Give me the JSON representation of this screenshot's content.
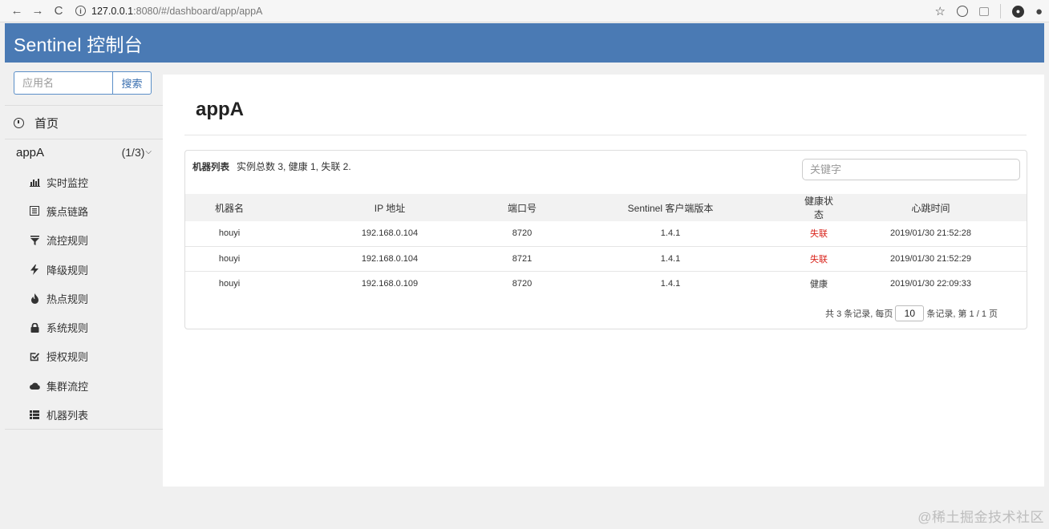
{
  "browser": {
    "url_host": "127.0.0.1",
    "url_rest": ":8080/#/dashboard/app/appA"
  },
  "header": {
    "title": "Sentinel 控制台"
  },
  "sidebar": {
    "search_placeholder": "应用名",
    "search_button": "搜索",
    "home_label": "首页",
    "app_name": "appA",
    "app_count": "(1/3)",
    "items": [
      {
        "label": "实时监控",
        "icon": "bar-chart-icon"
      },
      {
        "label": "簇点链路",
        "icon": "list-box-icon"
      },
      {
        "label": "流控规则",
        "icon": "filter-icon"
      },
      {
        "label": "降级规则",
        "icon": "flash-icon"
      },
      {
        "label": "热点规则",
        "icon": "fire-icon"
      },
      {
        "label": "系统规则",
        "icon": "lock-icon"
      },
      {
        "label": "授权规则",
        "icon": "check-square-icon"
      },
      {
        "label": "集群流控",
        "icon": "cloud-icon"
      },
      {
        "label": "机器列表",
        "icon": "th-list-icon"
      }
    ]
  },
  "main": {
    "title": "appA",
    "card_title": "机器列表",
    "summary": "实例总数 3, 健康 1, 失联 2.",
    "keyword_placeholder": "关键字",
    "columns": [
      "机器名",
      "IP 地址",
      "端口号",
      "Sentinel 客户端版本",
      "健康状态",
      "心跳时间"
    ],
    "rows": [
      {
        "name": "houyi",
        "ip": "192.168.0.104",
        "port": "8720",
        "version": "1.4.1",
        "status": "失联",
        "heartbeat": "2019/01/30 21:52:28"
      },
      {
        "name": "houyi",
        "ip": "192.168.0.104",
        "port": "8721",
        "version": "1.4.1",
        "status": "失联",
        "heartbeat": "2019/01/30 21:52:29"
      },
      {
        "name": "houyi",
        "ip": "192.168.0.109",
        "port": "8720",
        "version": "1.4.1",
        "status": "健康",
        "heartbeat": "2019/01/30 22:09:33"
      }
    ],
    "pager": {
      "prefix": "共 3 条记录, 每页",
      "page_size": "10",
      "suffix": "条记录, 第 1 / 1 页"
    }
  },
  "watermark": "@稀土掘金技术社区",
  "colors": {
    "header_bg": "#4a7ab4",
    "lost": "#d9241c"
  }
}
